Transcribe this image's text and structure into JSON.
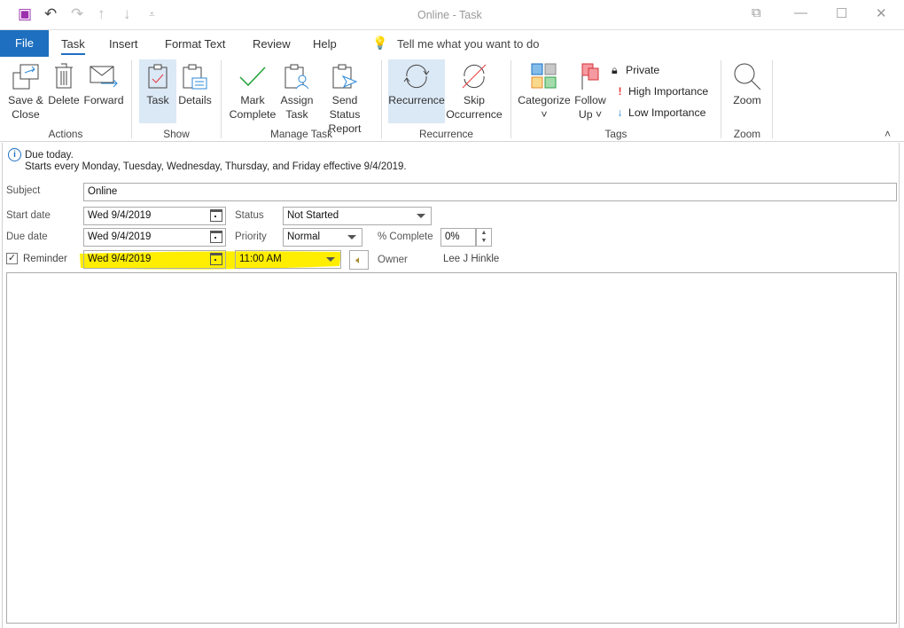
{
  "window": {
    "title": "Online  -  Task"
  },
  "tabs": {
    "file": "File",
    "items": [
      "Task",
      "Insert",
      "Format Text",
      "Review",
      "Help"
    ],
    "active": "Task",
    "tell_me": "Tell me what you want to do"
  },
  "ribbon": {
    "actions": {
      "label": "Actions",
      "save_close_1": "Save &",
      "save_close_2": "Close",
      "delete": "Delete",
      "forward": "Forward"
    },
    "show": {
      "label": "Show",
      "task": "Task",
      "details": "Details"
    },
    "manage": {
      "label": "Manage Task",
      "mark_1": "Mark",
      "mark_2": "Complete",
      "assign_1": "Assign",
      "assign_2": "Task",
      "send_1": "Send Status",
      "send_2": "Report"
    },
    "recurrence": {
      "label": "Recurrence",
      "recurrence": "Recurrence",
      "skip_1": "Skip",
      "skip_2": "Occurrence"
    },
    "tags": {
      "label": "Tags",
      "categorize": "Categorize",
      "follow_1": "Follow",
      "follow_2": "Up",
      "private": "Private",
      "high": "High Importance",
      "low": "Low Importance"
    },
    "zoom": {
      "label": "Zoom",
      "zoom": "Zoom"
    }
  },
  "info": {
    "line1": "Due today.",
    "line2": "Starts every Monday, Tuesday, Wednesday, Thursday, and Friday effective 9/4/2019."
  },
  "form": {
    "subject_label": "Subject",
    "subject": "Online",
    "start_label": "Start date",
    "start": "Wed 9/4/2019",
    "due_label": "Due date",
    "due": "Wed 9/4/2019",
    "status_label": "Status",
    "status": "Not Started",
    "priority_label": "Priority",
    "priority": "Normal",
    "complete_label": "% Complete",
    "complete": "0%",
    "reminder_label": "Reminder",
    "reminder_checked": true,
    "reminder_date": "Wed 9/4/2019",
    "reminder_time": "11:00 AM",
    "owner_label": "Owner",
    "owner": "Lee J Hinkle"
  },
  "colors": {
    "accent": "#1e6fbf",
    "highlight": "#ffee00",
    "selected": "#dbe8f5"
  }
}
